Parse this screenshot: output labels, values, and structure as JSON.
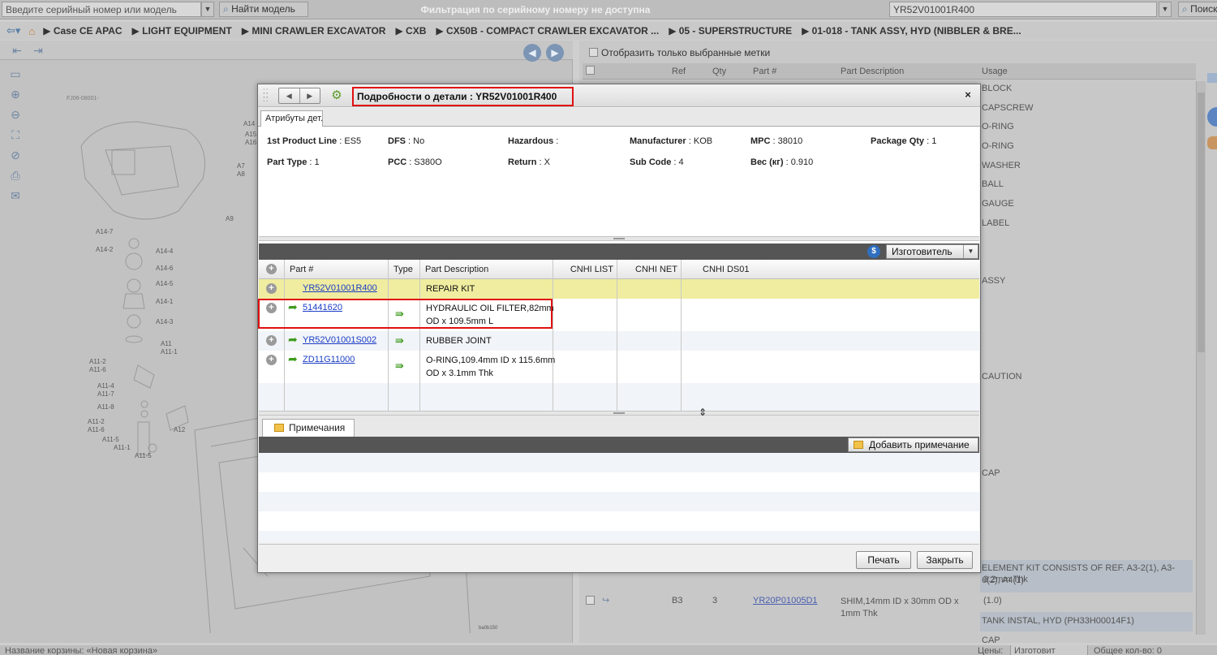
{
  "topbar": {
    "serial_placeholder": "Введите серийный номер или модель",
    "find_model_label": "Найти модель",
    "filter_message": "Фильтрация по серийному номеру не доступна",
    "model_value": "YR52V01001R400",
    "search_label": "Поиск"
  },
  "breadcrumb": [
    "▶ Case CE APAC",
    "▶ LIGHT EQUIPMENT",
    "▶ MINI CRAWLER EXCAVATOR",
    "▶ CXB",
    "▶ CX50B - COMPACT CRAWLER EXCAVATOR ...",
    "▶ 05 - SUPERSTRUCTURE",
    "▶ 01-018 - TANK ASSY, HYD (NIBBLER & BRE..."
  ],
  "diagram": {
    "code": "FJ06-08001-",
    "callouts": [
      "A14",
      "A15",
      "A16",
      "A7",
      "A8",
      "A9",
      "A14-7",
      "A14-2",
      "A14-4",
      "A14-6",
      "A14-5",
      "A14-1",
      "A14-3",
      "A11",
      "A11-1",
      "A11-2",
      "A11-6",
      "A11-4",
      "A11-7",
      "A11-8",
      "A11-2",
      "A11-6",
      "A11-5",
      "A11-1",
      "A11-5",
      "A12"
    ],
    "footer_code": "ba0b150"
  },
  "right_pane": {
    "show_selected_label": "Отобразить только выбранные метки",
    "columns": [
      "Ref",
      "Qty",
      "Part #",
      "Part Description",
      "Usage"
    ],
    "usage_rows": [
      "BLOCK",
      "CAPSCREW",
      "O-RING",
      "O-RING",
      "WASHER",
      "BALL",
      "GAUGE",
      "LABEL",
      "",
      "",
      "ASSY",
      "",
      "",
      "",
      "",
      "CAUTION",
      "",
      "",
      "",
      "",
      "CAP",
      "",
      "",
      "",
      "",
      "ELEMENT KIT CONSISTS OF REF. A3-2(1), A3-6(2), A4(1)",
      "",
      "TANK INSTAL, HYD (PH33H00014F1)",
      "CAP"
    ],
    "bottom_row": {
      "ref": "B3",
      "qty": "3",
      "part": "YR20P01005D1",
      "desc": "SHIM,14mm ID x 30mm OD x 1mm Thk",
      "usage": "(1.0)"
    },
    "partial_desc": "3.2mm Thk"
  },
  "statusbar": {
    "cart_label": "Название корзины: «Новая корзина»",
    "right_label": "Цены:",
    "right_select": "Изготовит",
    "total_label": "Общее кол-во: 0"
  },
  "modal": {
    "title": "Подробности о детали : YR52V01001R400",
    "close_label": "×",
    "tab_attributes": "Атрибуты дет...",
    "attributes": [
      {
        "label": "1st Product Line",
        "value": "ES5"
      },
      {
        "label": "DFS",
        "value": "No"
      },
      {
        "label": "Hazardous",
        "value": ""
      },
      {
        "label": "Manufacturer",
        "value": "KOB"
      },
      {
        "label": "MPC",
        "value": "38010"
      },
      {
        "label": "Package Qty",
        "value": "1"
      },
      {
        "label": "Part Type",
        "value": "1"
      },
      {
        "label": "PCC",
        "value": "S380O"
      },
      {
        "label": "Return",
        "value": "X"
      },
      {
        "label": "Sub Code",
        "value": "4"
      },
      {
        "label": "Вес (кг)",
        "value": "0.910"
      }
    ],
    "manufacturer_select": "Изготовитель",
    "columns": [
      "Part #",
      "Type",
      "Part Description",
      "CNHI LIST",
      "CNHI NET",
      "CNHI DS01"
    ],
    "rows": [
      {
        "part": "YR52V01001R400",
        "desc": [
          "REPAIR KIT"
        ],
        "has_arrow": false,
        "has_type": false,
        "highlight": true
      },
      {
        "part": "51441620",
        "desc": [
          "HYDRAULIC OIL FILTER,82mm",
          "OD x 109.5mm L"
        ],
        "has_arrow": true,
        "has_type": true,
        "highlight": false
      },
      {
        "part": "YR52V01001S002",
        "desc": [
          "RUBBER JOINT"
        ],
        "has_arrow": true,
        "has_type": true,
        "highlight": false
      },
      {
        "part": "ZD11G11000",
        "desc": [
          "O-RING,109.4mm ID x 115.6mm",
          "OD x 3.1mm Thk"
        ],
        "has_arrow": true,
        "has_type": true,
        "highlight": false
      }
    ],
    "notes_tab": "Примечания",
    "add_note_label": "Добавить примечание",
    "print_label": "Печать",
    "close_button_label": "Закрыть"
  }
}
